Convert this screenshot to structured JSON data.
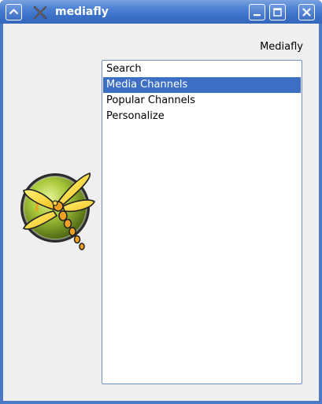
{
  "window": {
    "title": "mediafly",
    "app_icon": "mediafly-x-icon",
    "controls": [
      "shade-up-icon",
      "minimize-icon",
      "maximize-icon",
      "close-icon"
    ]
  },
  "header": {
    "brand_label": "Mediafly"
  },
  "logo": {
    "icon": "dragonfly-logo-icon"
  },
  "menu": {
    "items": [
      {
        "label": "Search",
        "selected": false
      },
      {
        "label": "Media Channels",
        "selected": true
      },
      {
        "label": "Popular Channels",
        "selected": false
      },
      {
        "label": "Personalize",
        "selected": false
      }
    ]
  },
  "colors": {
    "titlebar": "#4d82d4",
    "selection": "#3d6fc4",
    "background": "#efefef"
  }
}
